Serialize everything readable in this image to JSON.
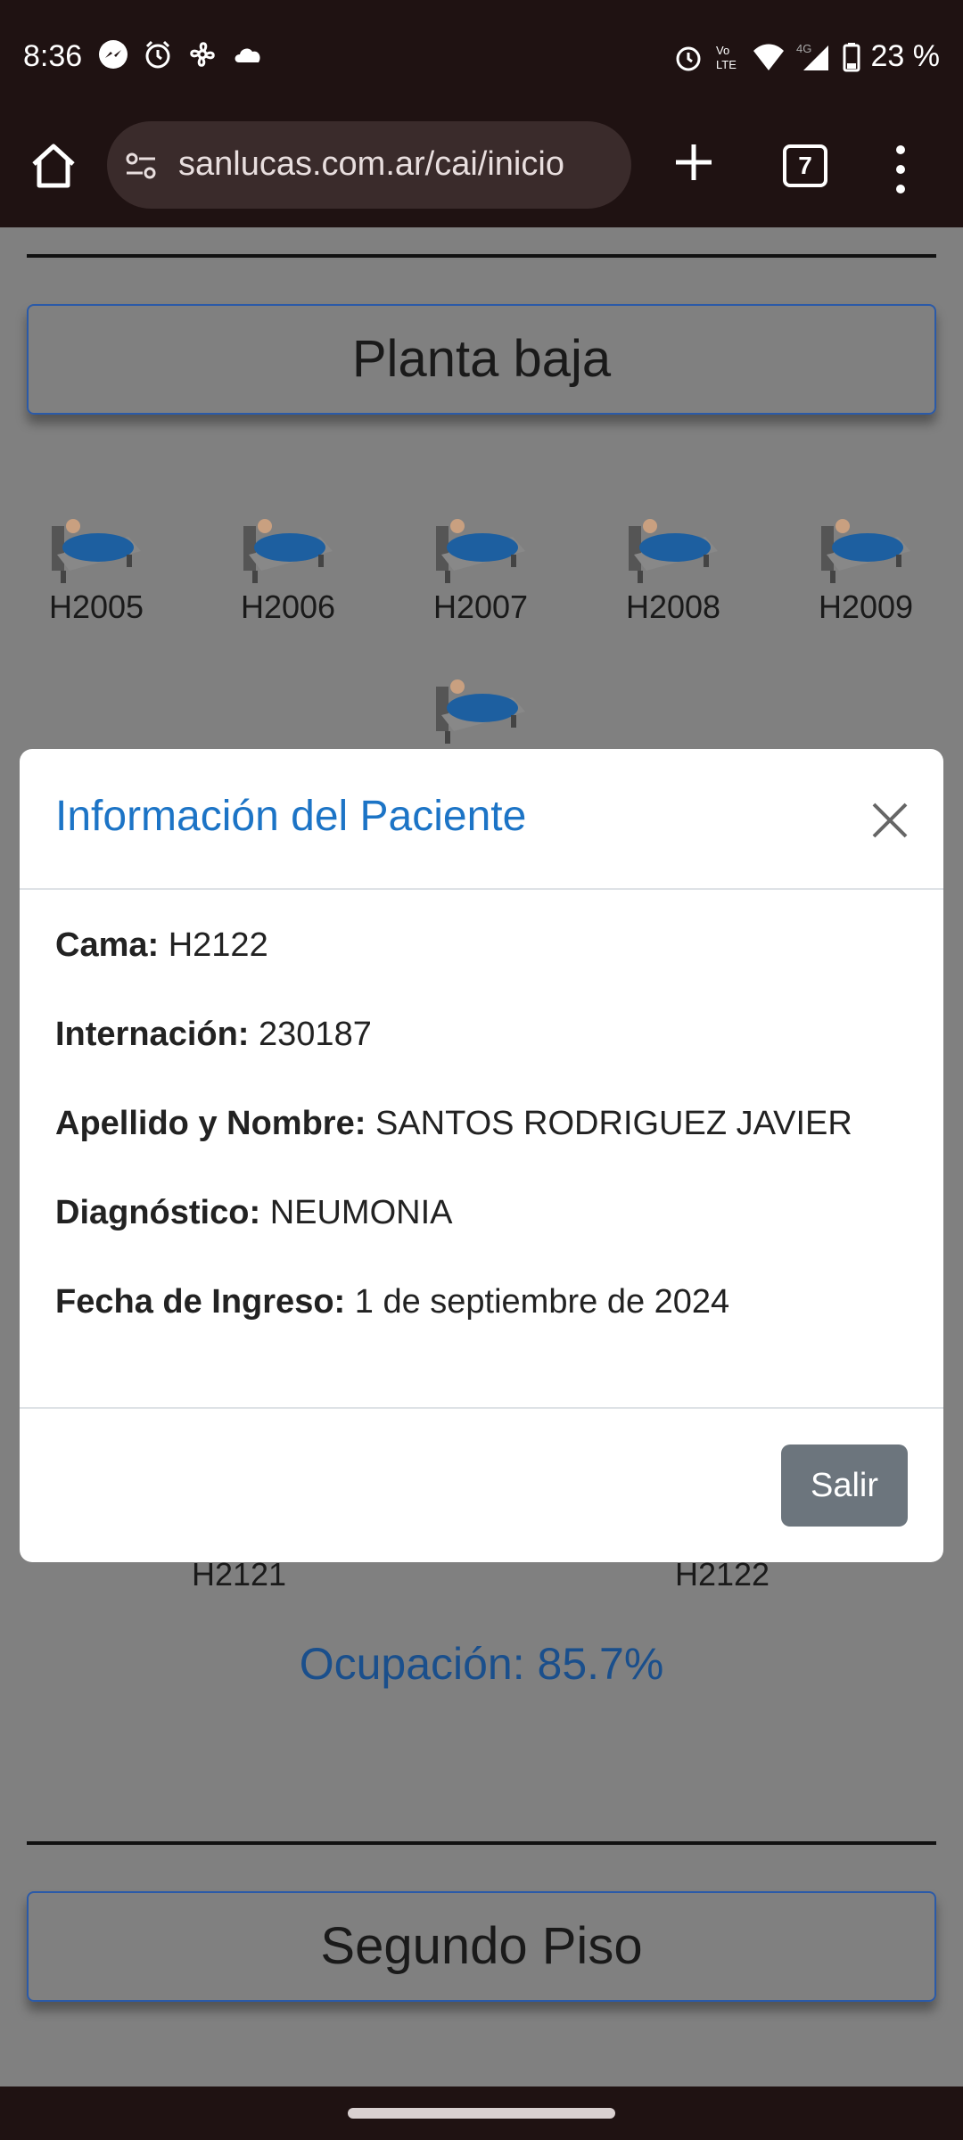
{
  "status_bar": {
    "time": "8:36",
    "battery": "23 %",
    "icons_left": [
      "messenger-icon",
      "alarm-icon",
      "fan-icon",
      "cloud-icon"
    ],
    "icons_right": [
      "alarm-icon",
      "volte-icon",
      "wifi-icon",
      "4g-signal-icon",
      "battery-icon"
    ]
  },
  "browser": {
    "url": "sanlucas.com.ar/cai/inicio",
    "tab_count": "7"
  },
  "page": {
    "floor1_title": "Planta baja",
    "beds_row1": [
      "H2005",
      "H2006",
      "H2007",
      "H2008",
      "H2009"
    ],
    "beds_bottom": [
      "H2121",
      "H2122"
    ],
    "ocupacion": "Ocupación: 85.7%",
    "floor2_title": "Segundo Piso"
  },
  "modal": {
    "title": "Información del Paciente",
    "fields": [
      {
        "label": "Cama:",
        "value": "H2122"
      },
      {
        "label": "Internación:",
        "value": "230187"
      },
      {
        "label": "Apellido y Nombre:",
        "value": "SANTOS RODRIGUEZ JAVIER"
      },
      {
        "label": "Diagnóstico:",
        "value": "NEUMONIA"
      },
      {
        "label": "Fecha de Ingreso:",
        "value": "1 de septiembre de 2024"
      }
    ],
    "close_button": "Salir"
  },
  "colors": {
    "modal_title": "#1c74c6",
    "ocupacion": "#1a4f8c",
    "salir_button": "#6c757d",
    "floor_button_border": "#2b5aa8"
  }
}
